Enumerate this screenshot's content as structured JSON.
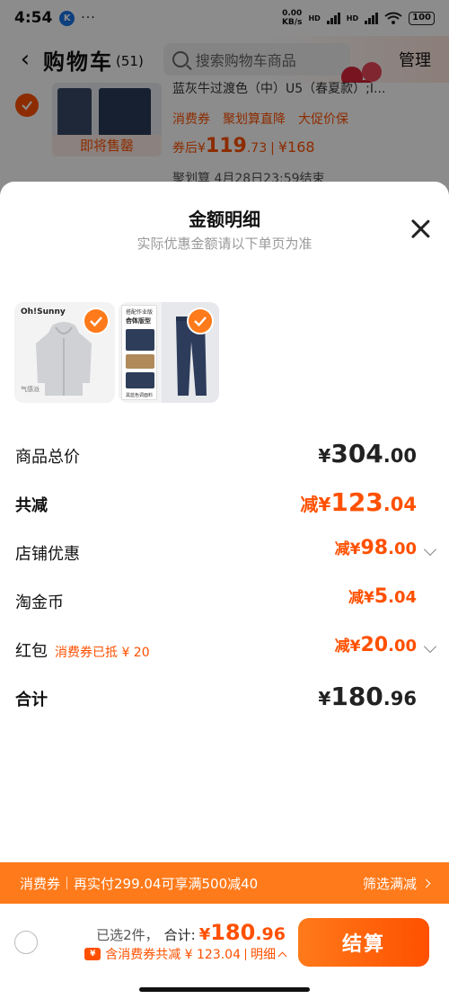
{
  "status_bar": {
    "time": "4:54",
    "app_badge": "K",
    "more": "···",
    "speed_value": "0.00",
    "speed_unit": "KB/s",
    "net1": "HD",
    "net2": "HD",
    "battery": "100"
  },
  "header": {
    "back": "‹",
    "title": "购物车",
    "count": "(51)",
    "search_placeholder": "搜索购物车商品",
    "manage": "管理"
  },
  "cart_item": {
    "name": "蓝灰牛过渡色（中）U5（春夏款）;I...",
    "presale": "即将售罄",
    "tags": [
      "消费券",
      "聚划算直降",
      "大促价保"
    ],
    "price_prefix": "券后",
    "price_currency": "¥",
    "price_int": "119",
    "price_dec": ".73",
    "orig_price": "¥168",
    "deadline": "聚划算 4月28日23:59结束"
  },
  "sheet": {
    "title": "金额明细",
    "subtitle": "实际优惠金额请以下单页为准",
    "products": [
      {
        "logo": "Oh!Sunny",
        "name": "hoodie",
        "caption": "气感派"
      },
      {
        "name": "jeans",
        "tag": "搭配作业版本介",
        "fit": "合体版型",
        "bottom": "黑蓝色调面料"
      }
    ]
  },
  "price_rows": {
    "total": {
      "label": "商品总价",
      "currency": "¥",
      "int": "304",
      "dec": ".00"
    },
    "reduced": {
      "label": "共减",
      "prefix": "减",
      "currency": "¥",
      "int": "123",
      "dec": ".04"
    },
    "shop_discount": {
      "label": "店铺优惠",
      "prefix": "减",
      "currency": "¥",
      "int": "98",
      "dec": ".00"
    },
    "coins": {
      "label": "淘金币",
      "prefix": "减",
      "currency": "¥",
      "int": "5",
      "dec": ".04"
    },
    "red_packet": {
      "label": "红包",
      "note": "消费券已抵 ¥ 20",
      "prefix": "减",
      "currency": "¥",
      "int": "20",
      "dec": ".00"
    },
    "grand": {
      "label": "合计",
      "currency": "¥",
      "int": "180",
      "dec": ".96"
    }
  },
  "promo": {
    "tag": "消费券",
    "text": "再实付299.04可享满500减40",
    "action": "筛选满减"
  },
  "bottom_bar": {
    "selected": "已选2件，",
    "total_label": "合计:",
    "total_currency": "¥",
    "total_int": "180",
    "total_dec": ".96",
    "coupon_icon": "¥",
    "discount_text": "含消费券共减 ¥ 123.04",
    "detail": "明细",
    "checkout": "结算"
  },
  "colors": {
    "accent": "#ff5000",
    "promo_bg": "#ff7a1a"
  }
}
